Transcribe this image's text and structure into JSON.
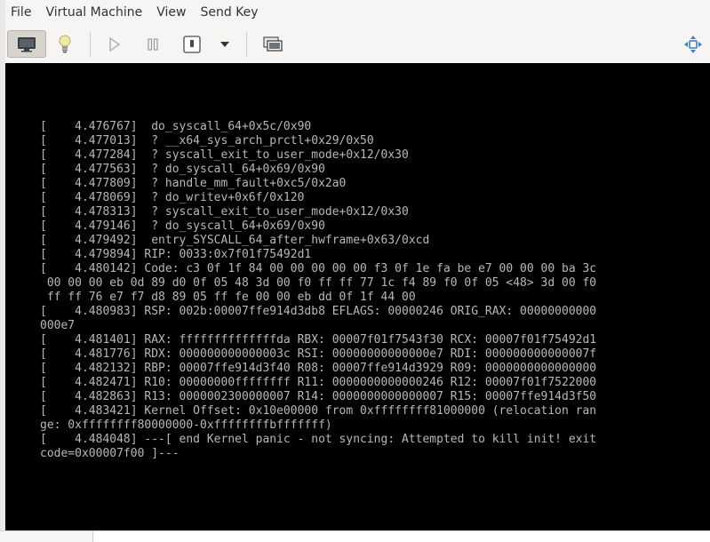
{
  "menubar": {
    "items": [
      "File",
      "Virtual Machine",
      "View",
      "Send Key"
    ]
  },
  "toolbar": {
    "buttons": [
      {
        "name": "console-view-button",
        "icon": "monitor-icon"
      },
      {
        "name": "details-view-button",
        "icon": "lightbulb-icon"
      },
      {
        "name": "run-button",
        "icon": "play-icon"
      },
      {
        "name": "pause-button",
        "icon": "pause-icon"
      },
      {
        "name": "shutdown-button",
        "icon": "power-icon"
      },
      {
        "name": "shutdown-menu-button",
        "icon": "chevron-down-icon"
      },
      {
        "name": "snapshots-button",
        "icon": "snapshots-icon"
      },
      {
        "name": "fullscreen-button",
        "icon": "move-arrows-icon"
      }
    ]
  },
  "console": {
    "lines": [
      "[    4.476767]  do_syscall_64+0x5c/0x90",
      "[    4.477013]  ? __x64_sys_arch_prctl+0x29/0x50",
      "[    4.477284]  ? syscall_exit_to_user_mode+0x12/0x30",
      "[    4.477563]  ? do_syscall_64+0x69/0x90",
      "[    4.477809]  ? handle_mm_fault+0xc5/0x2a0",
      "[    4.478069]  ? do_writev+0x6f/0x120",
      "[    4.478313]  ? syscall_exit_to_user_mode+0x12/0x30",
      "[    4.479146]  ? do_syscall_64+0x69/0x90",
      "[    4.479492]  entry_SYSCALL_64_after_hwframe+0x63/0xcd",
      "[    4.479894] RIP: 0033:0x7f01f75492d1",
      "[    4.480142] Code: c3 0f 1f 84 00 00 00 00 00 f3 0f 1e fa be e7 00 00 00 ba 3c",
      " 00 00 00 eb 0d 89 d0 0f 05 48 3d 00 f0 ff ff 77 1c f4 89 f0 0f 05 <48> 3d 00 f0",
      " ff ff 76 e7 f7 d8 89 05 ff fe 00 00 eb dd 0f 1f 44 00",
      "[    4.480983] RSP: 002b:00007ffe914d3db8 EFLAGS: 00000246 ORIG_RAX: 00000000000",
      "000e7",
      "[    4.481401] RAX: ffffffffffffffda RBX: 00007f01f7543f30 RCX: 00007f01f75492d1",
      "[    4.481776] RDX: 000000000000003c RSI: 00000000000000e7 RDI: 000000000000007f",
      "[    4.482132] RBP: 00007ffe914d3f40 R08: 00007ffe914d3929 R09: 0000000000000000",
      "[    4.482471] R10: 00000000ffffffff R11: 0000000000000246 R12: 00007f01f7522000",
      "[    4.482863] R13: 0000002300000007 R14: 0000000000000007 R15: 00007ffe914d3f50",
      "[    4.483421] Kernel Offset: 0x10e00000 from 0xffffffff81000000 (relocation ran",
      "ge: 0xffffffff80000000-0xffffffffbfffffff)",
      "[    4.484048] ---[ end Kernel panic - not syncing: Attempted to kill init! exit",
      "code=0x00007f00 ]---"
    ]
  }
}
